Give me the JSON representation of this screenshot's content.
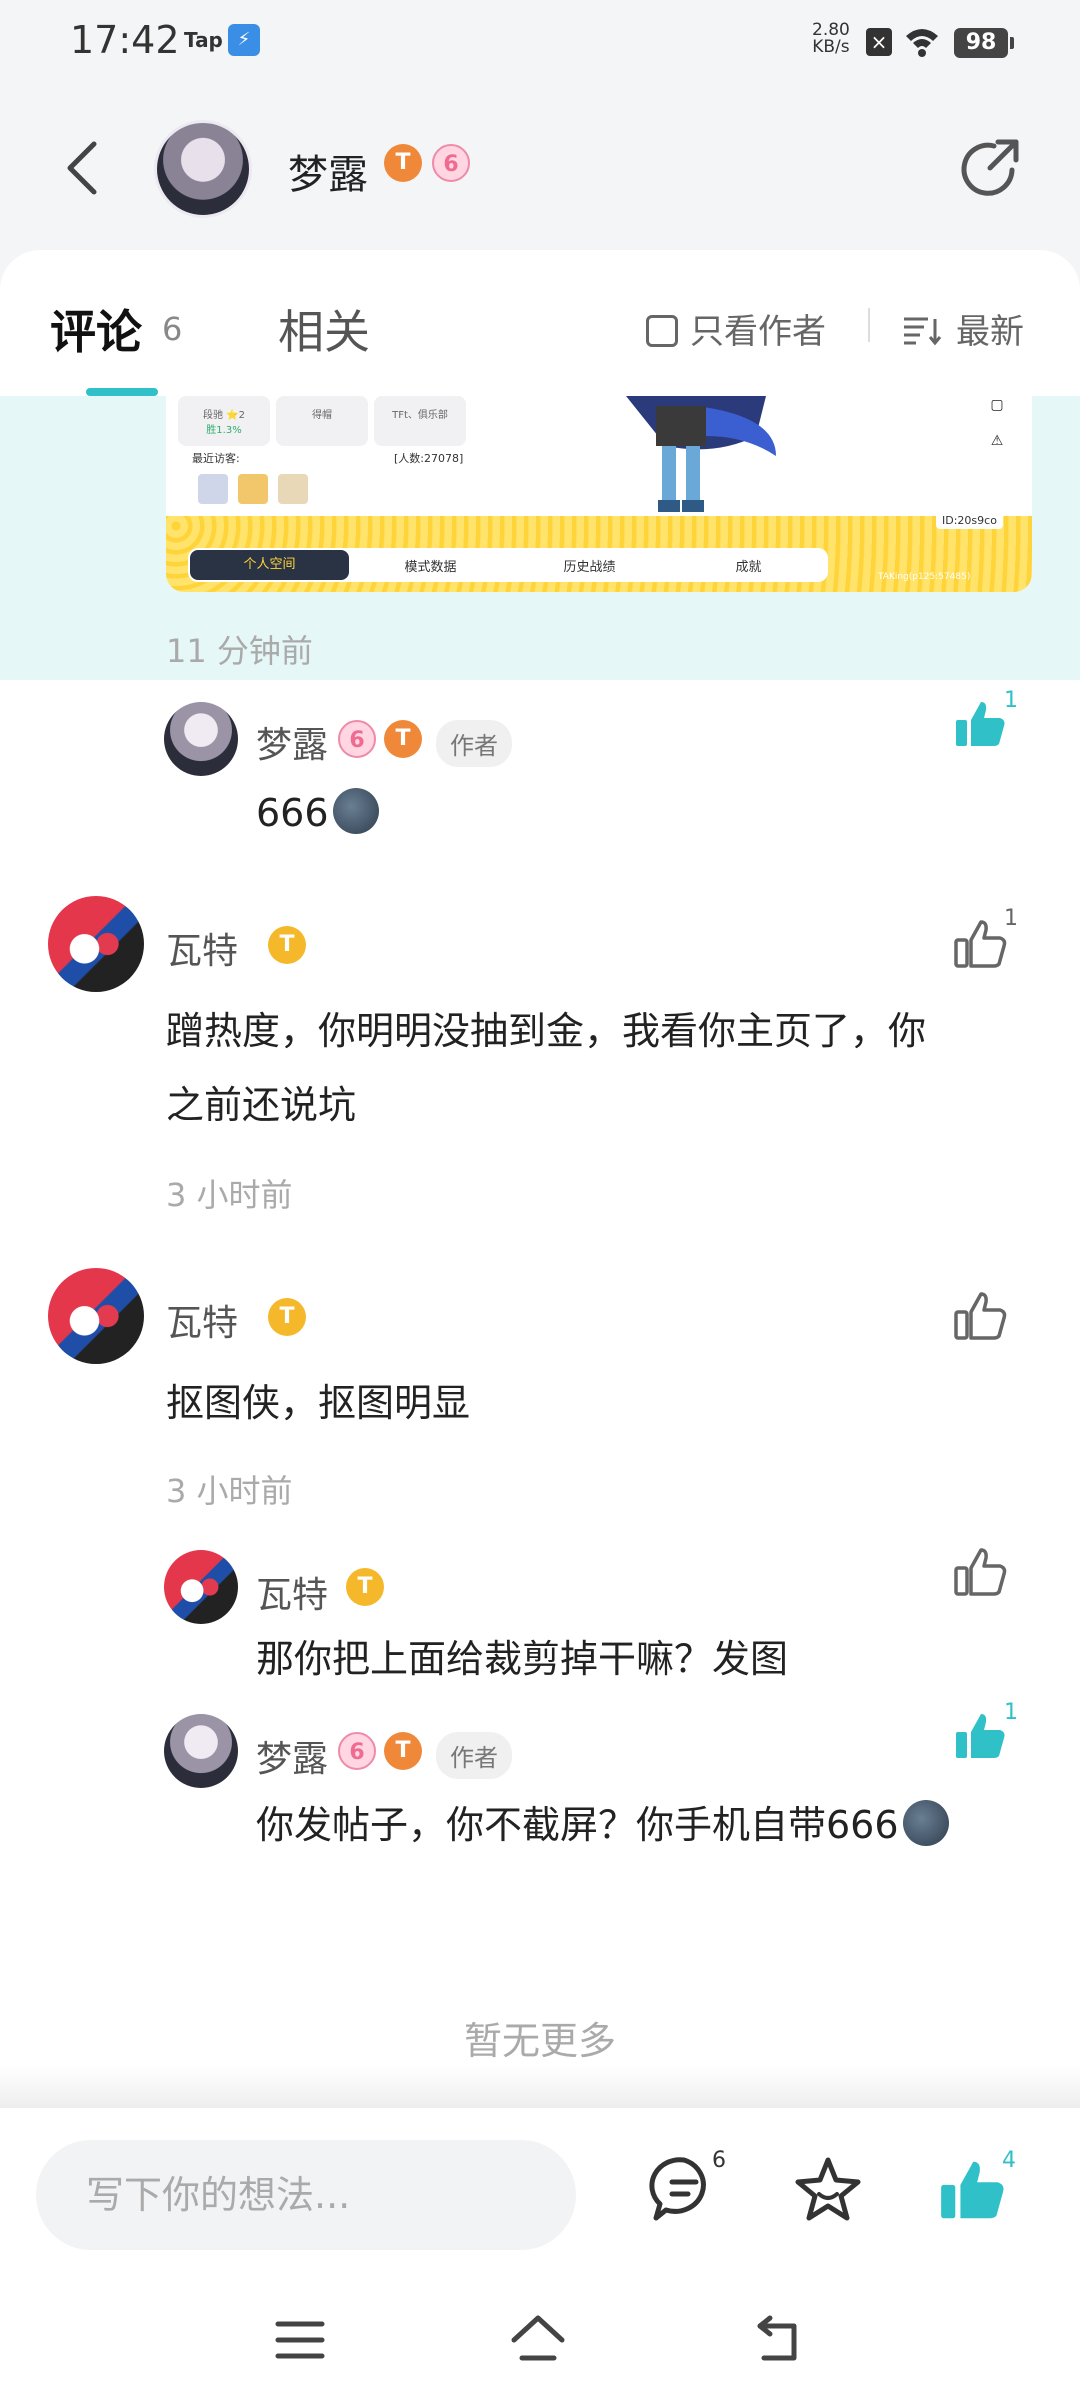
{
  "status_bar": {
    "time": "17:42",
    "tap": "Tap",
    "speed_top": "2.80",
    "speed_bottom": "KB/s",
    "battery": "98"
  },
  "header": {
    "user_name": "梦露",
    "badge_t": "T",
    "badge_e": "6"
  },
  "tabs": {
    "comments_label": "评论",
    "comments_count": "6",
    "related_label": "相关",
    "author_only_label": "只看作者",
    "sort_label": "最新"
  },
  "embedded_screenshot": {
    "card_1_line1": "段驰 ⭐2",
    "card_1_line2": "胜1.3%",
    "card_2": "得帽",
    "card_3": "TFt、俱乐部",
    "recent_visitors": "最近访客:",
    "people": "[人数:27078]",
    "tabs": [
      "个人空间",
      "模式数据",
      "历史战绩",
      "成就"
    ],
    "id_label": "ID:20s9co",
    "uid_text": "TAKing(p125:57485)"
  },
  "highlight_time": "11 分钟前",
  "comments": [
    {
      "name": "梦露",
      "author_tag": "作者",
      "text": "666",
      "likes": "1"
    },
    {
      "name": "瓦特",
      "text_line1": "蹭热度，你明明没抽到金，我看你主页了，你",
      "text_line2": "之前还说坑",
      "time": "3 小时前",
      "likes": "1"
    },
    {
      "name": "瓦特",
      "text": "抠图侠，抠图明显",
      "time": "3 小时前"
    },
    {
      "name": "瓦特",
      "text": "那你把上面给裁剪掉干嘛？发图"
    },
    {
      "name": "梦露",
      "author_tag": "作者",
      "text": "你发帖子，你不截屏？你手机自带666",
      "likes": "1"
    }
  ],
  "no_more": "暂无更多",
  "bottom_bar": {
    "input_placeholder": "写下你的想法...",
    "comment_count": "6",
    "like_count": "4"
  },
  "colors": {
    "accent": "#2fc0c8",
    "badge_orange": "#f0883a",
    "badge_pink": "#ef6b92",
    "badge_gold": "#f5b82a"
  }
}
